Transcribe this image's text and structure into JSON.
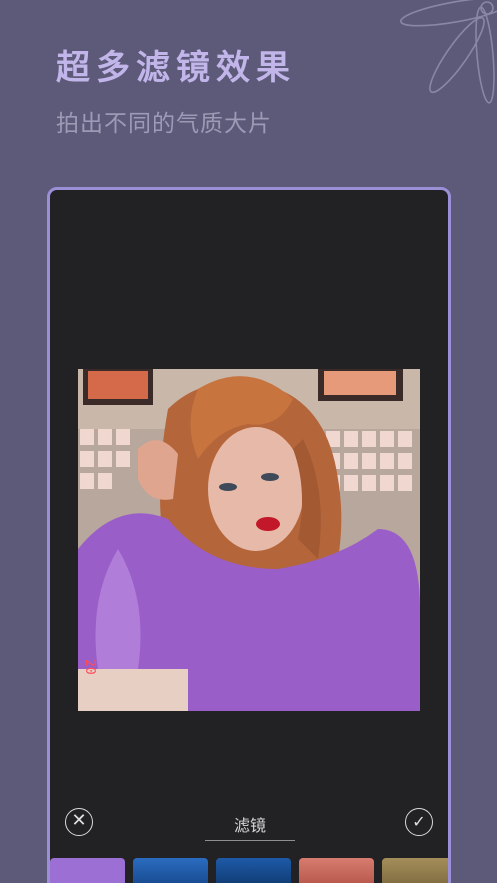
{
  "header": {
    "title": "超多滤镜效果",
    "subtitle": "拍出不同的气质大片"
  },
  "editor": {
    "tab_label": "滤镜",
    "photo_stamp": "20"
  },
  "filters": [
    {
      "name": "thumb-lavender",
      "color": "#9b6fd4"
    },
    {
      "name": "thumb-blue",
      "color": "#1c4f9c"
    },
    {
      "name": "thumb-deep-blue",
      "color": "#0f3d7c"
    },
    {
      "name": "thumb-red-tree",
      "color": "#c96a5c"
    },
    {
      "name": "thumb-sepia",
      "color": "#8f7a4a"
    }
  ],
  "colors": {
    "background": "#5c5a78",
    "accent": "#9b8fd8",
    "panel": "#222224"
  }
}
